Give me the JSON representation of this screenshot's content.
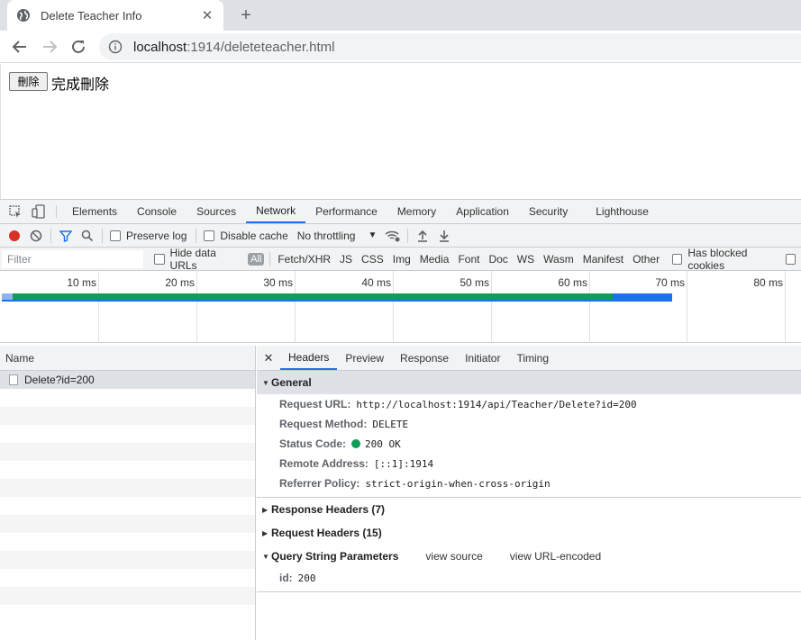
{
  "browser": {
    "tab_title": "Delete Teacher Info",
    "tab_close": "✕",
    "new_tab": "+",
    "url_host": "localhost",
    "url_rest": ":1914/deleteteacher.html"
  },
  "page": {
    "delete_button": "刪除",
    "result_text": "完成刪除"
  },
  "devtools": {
    "tabs": [
      "Elements",
      "Console",
      "Sources",
      "Network",
      "Performance",
      "Memory",
      "Application",
      "Security",
      "Lighthouse"
    ],
    "active_tab": "Network",
    "toolbar": {
      "preserve_log": "Preserve log",
      "disable_cache": "Disable cache",
      "throttling": "No throttling"
    },
    "filter": {
      "placeholder": "Filter",
      "hide_data_urls": "Hide data URLs",
      "types": [
        "All",
        "Fetch/XHR",
        "JS",
        "CSS",
        "Img",
        "Media",
        "Font",
        "Doc",
        "WS",
        "Wasm",
        "Manifest",
        "Other"
      ],
      "has_blocked_cookies": "Has blocked cookies"
    },
    "overview": {
      "ticks": [
        "10 ms",
        "20 ms",
        "30 ms",
        "40 ms",
        "50 ms",
        "60 ms",
        "70 ms",
        "80 ms"
      ]
    },
    "requests": {
      "column": "Name",
      "rows": [
        "Delete?id=200"
      ]
    },
    "detail": {
      "close": "✕",
      "tabs": [
        "Headers",
        "Preview",
        "Response",
        "Initiator",
        "Timing"
      ],
      "active_tab": "Headers",
      "general": {
        "title": "General",
        "request_url_label": "Request URL:",
        "request_url": "http://localhost:1914/api/Teacher/Delete?id=200",
        "request_method_label": "Request Method:",
        "request_method": "DELETE",
        "status_code_label": "Status Code:",
        "status_code": "200 OK",
        "remote_address_label": "Remote Address:",
        "remote_address": "[::1]:1914",
        "referrer_policy_label": "Referrer Policy:",
        "referrer_policy": "strict-origin-when-cross-origin"
      },
      "response_headers": "Response Headers (7)",
      "request_headers": "Request Headers (15)",
      "query": {
        "title": "Query String Parameters",
        "view_source": "view source",
        "view_url_encoded": "view URL-encoded",
        "param_key": "id:",
        "param_value": "200"
      }
    },
    "colors": {
      "accent": "#1a73e8",
      "status_ok": "#0f9d58",
      "record": "#d93025"
    }
  }
}
